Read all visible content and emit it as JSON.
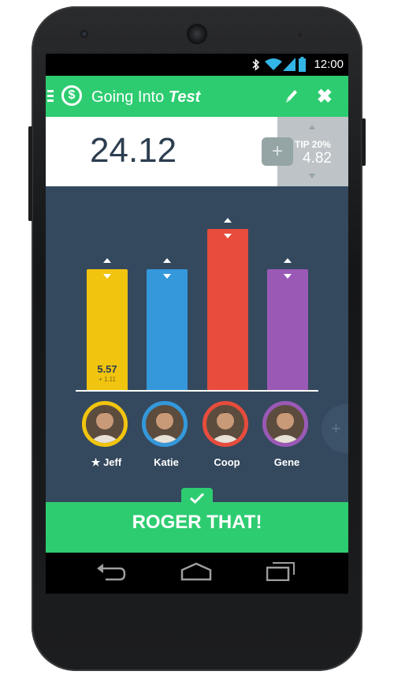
{
  "status": {
    "time": "12:00"
  },
  "appbar": {
    "title_plain": "Going Into",
    "title_emph": "Test",
    "logo_glyph": "$",
    "close_glyph": "✖"
  },
  "bill": {
    "amount": "24.12",
    "add_glyph": "+",
    "tip_label": "TIP 20%",
    "tip_value": "4.82"
  },
  "chart_data": {
    "type": "bar",
    "categories": [
      "Jeff",
      "Katie",
      "Coop",
      "Gene"
    ],
    "values": [
      5.57,
      5.57,
      7.41,
      5.57
    ],
    "colors": [
      "#f1c40f",
      "#3498db",
      "#e74c3c",
      "#9b59b6"
    ],
    "labels": [
      {
        "index": 0,
        "value": "5.57",
        "sub": "+ 1.11"
      }
    ]
  },
  "people": [
    {
      "name": "Jeff",
      "star": "★",
      "color": "#f1c40f"
    },
    {
      "name": "Katie",
      "color": "#3498db"
    },
    {
      "name": "Coop",
      "color": "#e74c3c"
    },
    {
      "name": "Gene",
      "color": "#9b59b6"
    }
  ],
  "add_person_glyph": "+",
  "footer": {
    "confirm_label": "ROGER THAT!"
  },
  "theme": {
    "green": "#2ecc71",
    "navy": "#34495e",
    "dark_text": "#2c3e50"
  }
}
